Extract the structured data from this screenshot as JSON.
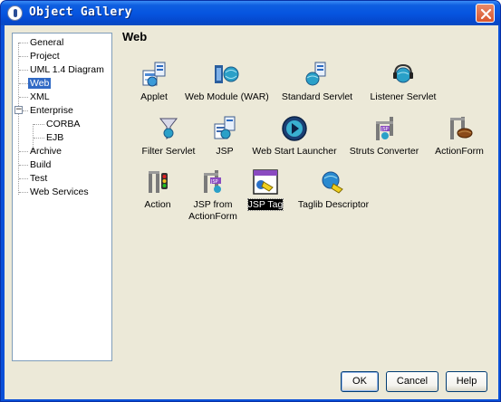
{
  "window": {
    "title": "Object Gallery"
  },
  "tree": {
    "items": [
      {
        "label": "General"
      },
      {
        "label": "Project"
      },
      {
        "label": "UML 1.4 Diagram"
      },
      {
        "label": "Web",
        "selected": true
      },
      {
        "label": "XML"
      },
      {
        "label": "Enterprise",
        "expanded": true
      },
      {
        "label": "CORBA"
      },
      {
        "label": "EJB"
      },
      {
        "label": "Archive"
      },
      {
        "label": "Build"
      },
      {
        "label": "Test"
      },
      {
        "label": "Web Services"
      }
    ]
  },
  "content": {
    "heading": "Web",
    "items": [
      {
        "label": "Applet",
        "icon": "applet-icon"
      },
      {
        "label": "Web Module (WAR)",
        "icon": "web-module-icon"
      },
      {
        "label": "Standard Servlet",
        "icon": "servlet-icon"
      },
      {
        "label": "Listener Servlet",
        "icon": "listener-servlet-icon"
      },
      {
        "label": "Filter Servlet",
        "icon": "filter-servlet-icon"
      },
      {
        "label": "JSP",
        "icon": "jsp-icon"
      },
      {
        "label": "Web Start Launcher",
        "icon": "web-start-icon"
      },
      {
        "label": "Struts Converter",
        "icon": "struts-converter-icon"
      },
      {
        "label": "ActionForm",
        "icon": "actionform-icon"
      },
      {
        "label": "Action",
        "icon": "action-icon"
      },
      {
        "label": "JSP from",
        "label2": "ActionForm",
        "icon": "jsp-from-actionform-icon"
      },
      {
        "label": "JSP Tag",
        "icon": "jsp-tag-icon",
        "selected": true
      },
      {
        "label": "Taglib Descriptor",
        "icon": "taglib-icon"
      }
    ]
  },
  "buttons": {
    "ok": "OK",
    "cancel": "Cancel",
    "help": "Help"
  }
}
